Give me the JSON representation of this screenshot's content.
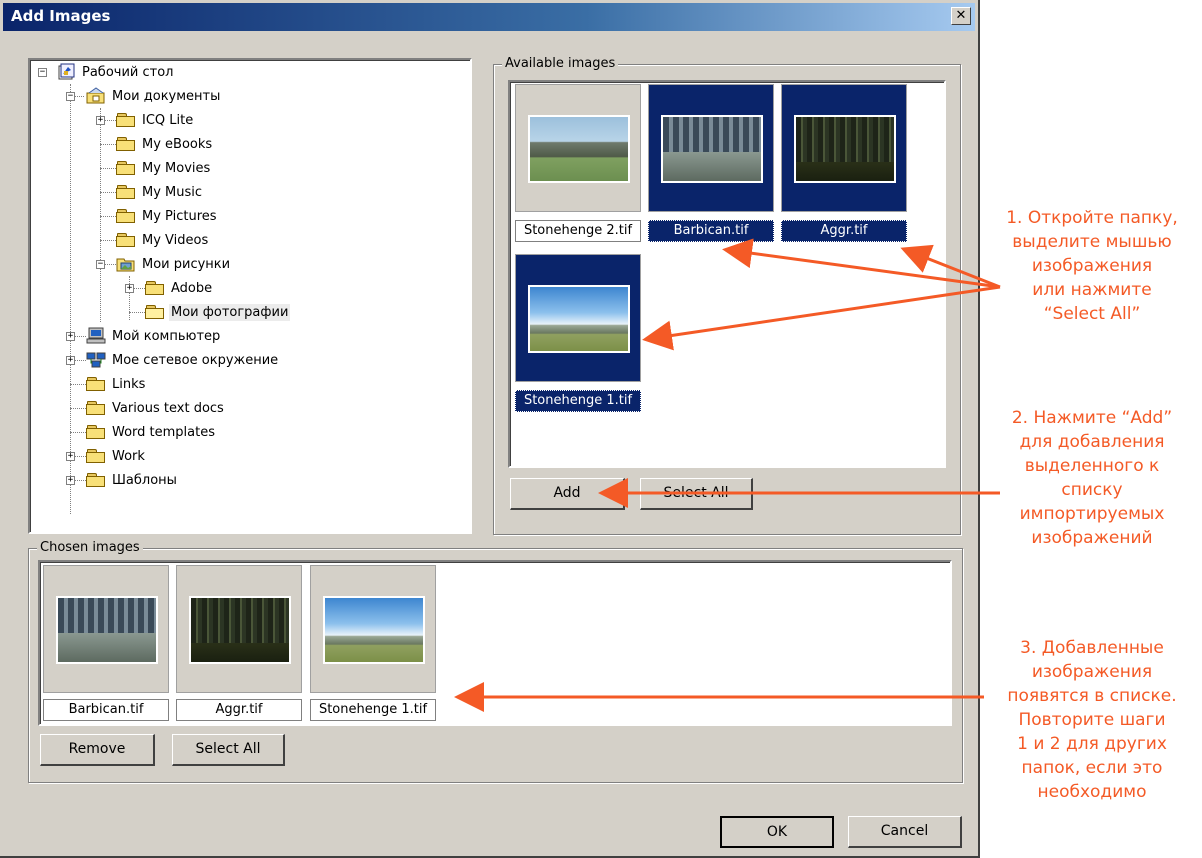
{
  "dialog": {
    "title": "Add Images",
    "close_label": "✕"
  },
  "tree": {
    "items": [
      {
        "label": "Рабочий стол"
      },
      {
        "label": "Мои документы"
      },
      {
        "label": "ICQ Lite"
      },
      {
        "label": "My eBooks"
      },
      {
        "label": "My Movies"
      },
      {
        "label": "My Music"
      },
      {
        "label": "My Pictures"
      },
      {
        "label": "My Videos"
      },
      {
        "label": "Мои рисунки"
      },
      {
        "label": "Adobe"
      },
      {
        "label": "Мои фотографии"
      },
      {
        "label": "Мой компьютер"
      },
      {
        "label": "Мое сетевое окружение"
      },
      {
        "label": "Links"
      },
      {
        "label": "Various text docs"
      },
      {
        "label": "Word templates"
      },
      {
        "label": "Work"
      },
      {
        "label": "Шаблоны"
      }
    ],
    "selected": "Мои фотографии"
  },
  "available": {
    "label": "Available images",
    "images": [
      {
        "name": "Stonehenge 2.tif",
        "selected": false
      },
      {
        "name": "Barbican.tif",
        "selected": true
      },
      {
        "name": "Aggr.tif",
        "selected": true
      },
      {
        "name": "Stonehenge 1.tif",
        "selected": true
      }
    ],
    "add_label": "Add",
    "select_all_label": "Select All"
  },
  "chosen": {
    "label": "Chosen images",
    "images": [
      {
        "name": "Barbican.tif"
      },
      {
        "name": "Aggr.tif"
      },
      {
        "name": "Stonehenge 1.tif"
      }
    ],
    "remove_label": "Remove",
    "select_all_label": "Select All"
  },
  "footer": {
    "ok_label": "OK",
    "cancel_label": "Cancel"
  },
  "annotations": {
    "step1": [
      "1. Откройте папку,",
      "выделите мышью",
      "изображения",
      "или нажмите",
      "“Select All”"
    ],
    "step2": [
      "2. Нажмите “Add”",
      "для добавления",
      "выделенного к",
      "списку",
      "импортируемых",
      "изображений"
    ],
    "step3": [
      "3. Добавленные",
      "изображения",
      "появятся в списке.",
      "Повторите шаги",
      "1 и 2 для других",
      "папок, если это",
      "необходимо"
    ]
  },
  "colors": {
    "annotation": "#f45a26",
    "selection": "#0a246a",
    "dialog_face": "#d4d0c8"
  }
}
